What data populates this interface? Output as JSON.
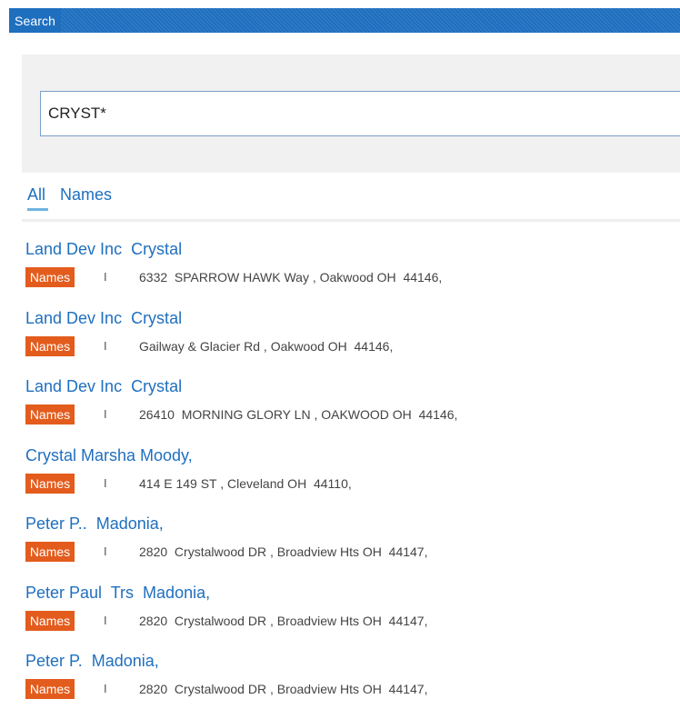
{
  "window": {
    "title": "Search"
  },
  "search": {
    "value": "CRYST*"
  },
  "tabs": [
    {
      "label": "All"
    },
    {
      "label": "Names"
    }
  ],
  "results": [
    {
      "title": "Land Dev Inc  Crystal",
      "badge": "Names",
      "sep": "I",
      "address": "6332  SPARROW HAWK Way , Oakwood OH  44146,"
    },
    {
      "title": "Land Dev Inc  Crystal",
      "badge": "Names",
      "sep": "I",
      "address": "Gailway & Glacier Rd , Oakwood OH  44146,"
    },
    {
      "title": "Land Dev Inc  Crystal",
      "badge": "Names",
      "sep": "I",
      "address": "26410  MORNING GLORY LN , OAKWOOD OH  44146,"
    },
    {
      "title": "Crystal Marsha Moody,",
      "badge": "Names",
      "sep": "I",
      "address": "414 E 149 ST , Cleveland OH  44110,"
    },
    {
      "title": "Peter P..  Madonia,",
      "badge": "Names",
      "sep": "I",
      "address": "2820  Crystalwood DR , Broadview Hts OH  44147,"
    },
    {
      "title": "Peter Paul  Trs  Madonia,",
      "badge": "Names",
      "sep": "I",
      "address": "2820  Crystalwood DR , Broadview Hts OH  44147,"
    },
    {
      "title": "Peter P.  Madonia,",
      "badge": "Names",
      "sep": "I",
      "address": "2820  Crystalwood DR , Broadview Hts OH  44147,"
    }
  ]
}
